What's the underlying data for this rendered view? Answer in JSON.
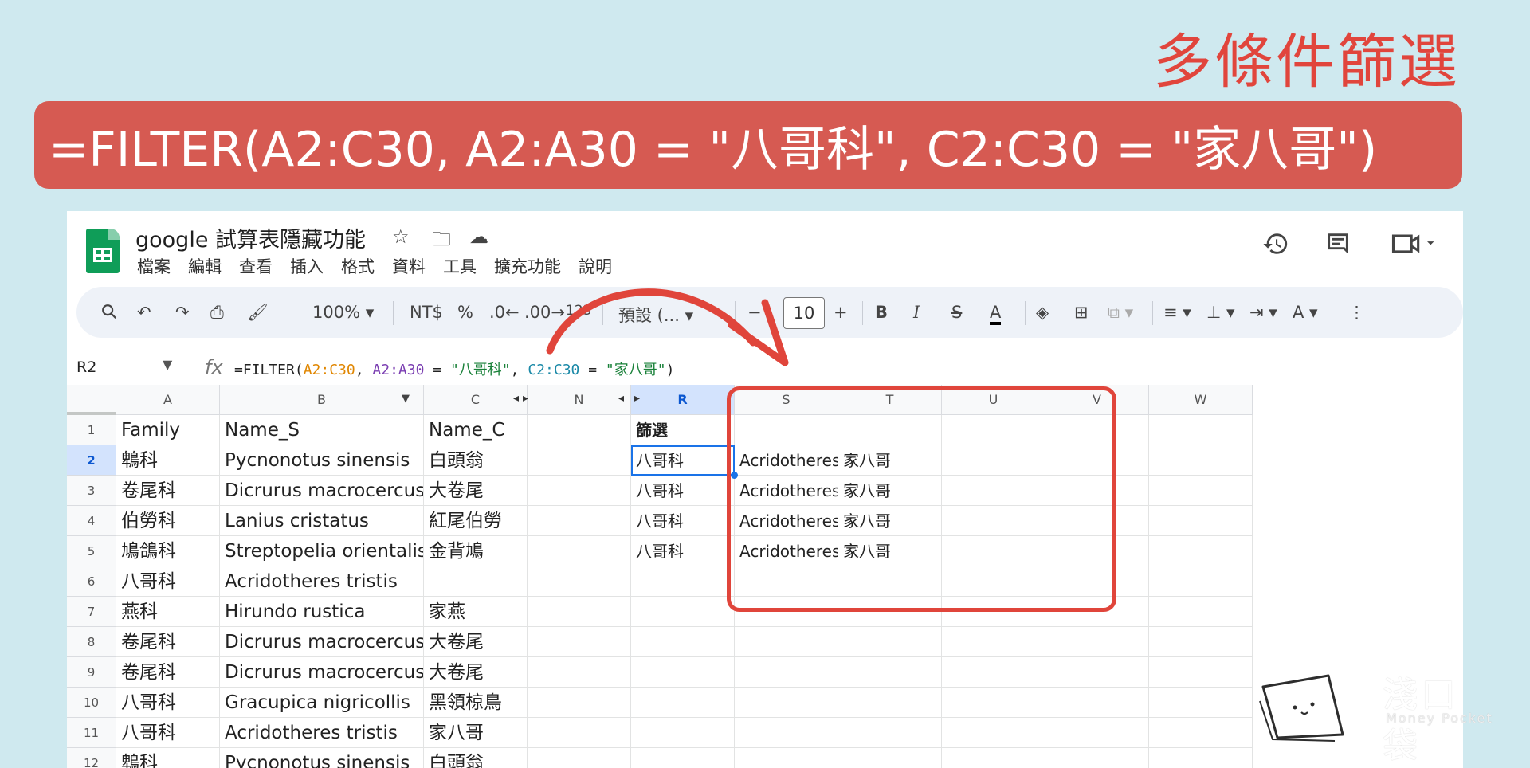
{
  "overlay": {
    "heading": "多條件篩選",
    "formula_banner": "=FILTER(A2:C30, A2:A30 = \"八哥科\", C2:C30 = \"家八哥\")",
    "highlight_color": "#e0453b"
  },
  "app": {
    "doc_title": "google 試算表隱藏功能",
    "menu": [
      "檔案",
      "編輯",
      "查看",
      "插入",
      "格式",
      "資料",
      "工具",
      "擴充功能",
      "說明"
    ],
    "icons": [
      "star-icon",
      "move-to-folder-icon",
      "cloud-saved-icon",
      "history-icon",
      "comment-icon",
      "meet-icon"
    ]
  },
  "toolbar": {
    "zoom": "100%",
    "currency": "NT$",
    "percent": "%",
    "decrease_decimal": ".0",
    "increase_decimal": ".00",
    "number_format": "123",
    "font": "預設 (...",
    "font_size": "10",
    "minus": "−",
    "plus": "+",
    "bold": "B",
    "italic": "I",
    "strike": "S",
    "text_color": "A",
    "text_rotate": "A"
  },
  "formula_bar": {
    "name_box": "R2",
    "fx": "fx",
    "segments": [
      {
        "text": "=FILTER(",
        "color": "#222222"
      },
      {
        "text": "A2:C30",
        "color": "#e08600"
      },
      {
        "text": ", ",
        "color": "#222222"
      },
      {
        "text": "A2:A30",
        "color": "#7b3fb2"
      },
      {
        "text": " = ",
        "color": "#222222"
      },
      {
        "text": "\"八哥科\"",
        "color": "#188038"
      },
      {
        "text": ", ",
        "color": "#222222"
      },
      {
        "text": "C2:C30",
        "color": "#1c8aa8"
      },
      {
        "text": " = ",
        "color": "#222222"
      },
      {
        "text": "\"家八哥\"",
        "color": "#188038"
      },
      {
        "text": ")",
        "color": "#222222"
      }
    ]
  },
  "columns": [
    "A",
    "B",
    "C",
    "N",
    "R",
    "S",
    "T",
    "U",
    "V",
    "W"
  ],
  "rows": [
    {
      "num": "1",
      "A": "Family",
      "B": "Name_S",
      "C": "Name_C"
    },
    {
      "num": "2",
      "A": "鵯科",
      "B": "Pycnonotus sinensis",
      "C": "白頭翁"
    },
    {
      "num": "3",
      "A": "卷尾科",
      "B": "Dicrurus macrocercus",
      "C": "大卷尾"
    },
    {
      "num": "4",
      "A": "伯勞科",
      "B": "Lanius cristatus",
      "C": "紅尾伯勞"
    },
    {
      "num": "5",
      "A": "鳩鴿科",
      "B": "Streptopelia orientalis",
      "C": "金背鳩"
    },
    {
      "num": "6",
      "A": "八哥科",
      "B": "Acridotheres tristis",
      "C": ""
    },
    {
      "num": "7",
      "A": "燕科",
      "B": "Hirundo rustica",
      "C": "家燕"
    },
    {
      "num": "8",
      "A": "卷尾科",
      "B": "Dicrurus macrocercus",
      "C": "大卷尾"
    },
    {
      "num": "9",
      "A": "卷尾科",
      "B": "Dicrurus macrocercus",
      "C": "大卷尾"
    },
    {
      "num": "10",
      "A": "八哥科",
      "B": "Gracupica nigricollis",
      "C": "黑領椋鳥"
    },
    {
      "num": "11",
      "A": "八哥科",
      "B": "Acridotheres tristis",
      "C": "家八哥"
    },
    {
      "num": "12",
      "A": "鵯科",
      "B": "Pycnonotus sinensis",
      "C": "白頭翁"
    }
  ],
  "filter_result": {
    "header": "篩選",
    "rows": [
      [
        "八哥科",
        "Acridotheres tris",
        "家八哥"
      ],
      [
        "八哥科",
        "Acridotheres tris",
        "家八哥"
      ],
      [
        "八哥科",
        "Acridotheres tris",
        "家八哥"
      ],
      [
        "八哥科",
        "Acridotheres tris",
        "家八哥"
      ]
    ]
  },
  "watermark": {
    "brand": "淺口袋",
    "sub": "Money Pocket"
  }
}
